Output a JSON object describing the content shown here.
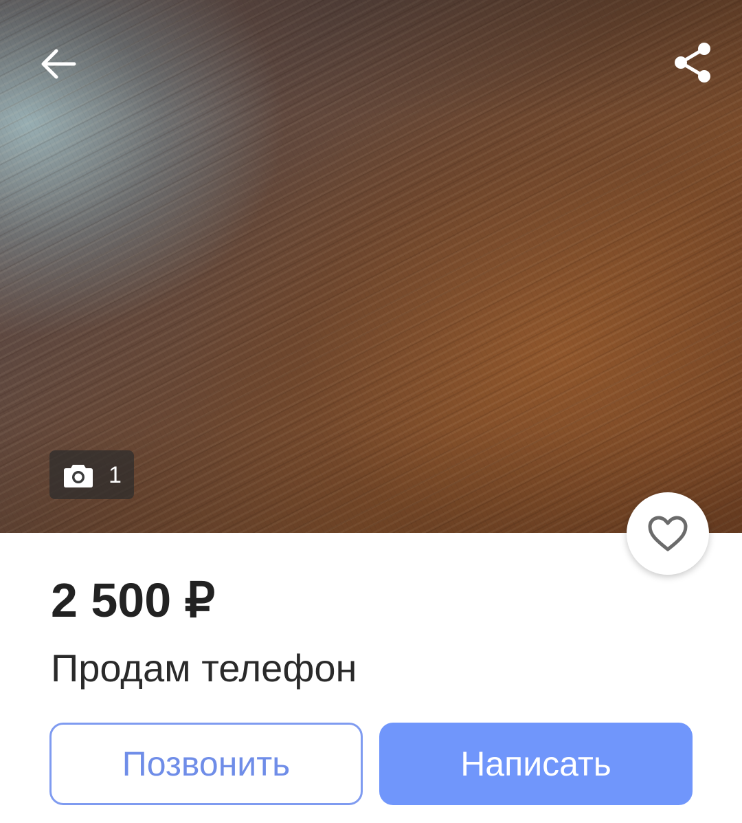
{
  "listing": {
    "price": "2 500 ₽",
    "title": "Продам телефон",
    "photo_count": "1"
  },
  "actions": {
    "call_label": "Позвонить",
    "write_label": "Написать"
  },
  "icons": {
    "back": "arrow-left-icon",
    "share": "share-icon",
    "camera": "camera-icon",
    "favorite": "heart-outline-icon"
  },
  "colors": {
    "accent": "#7096fb",
    "accent_outline": "#7f9bf0",
    "text_primary": "#222222"
  }
}
